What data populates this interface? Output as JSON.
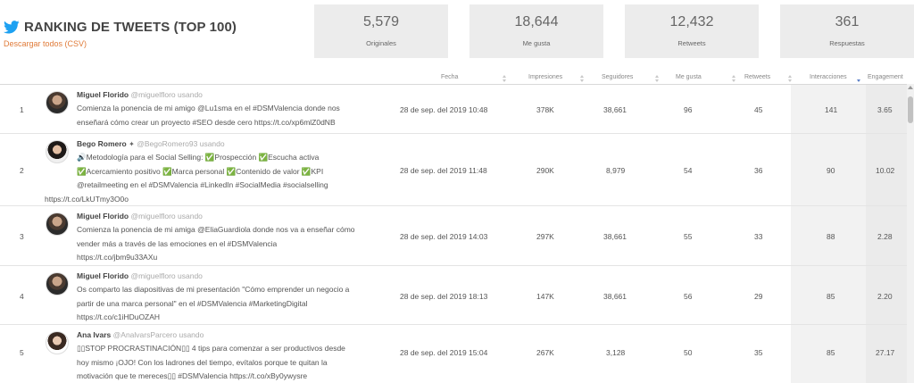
{
  "header": {
    "title": "RANKING DE TWEETS (TOP 100)",
    "download_label": "Descargar todos (CSV)",
    "stats": [
      {
        "value": "5,579",
        "label": "Originales"
      },
      {
        "value": "18,644",
        "label": "Me gusta"
      },
      {
        "value": "12,432",
        "label": "Retweets"
      },
      {
        "value": "361",
        "label": "Respuestas"
      }
    ]
  },
  "columns": {
    "fecha": "Fecha",
    "impresiones": "Impresiones",
    "seguidores": "Seguidores",
    "megusta": "Me gusta",
    "retweets": "Retweets",
    "interacciones": "Interacciones",
    "engagement": "Engagement"
  },
  "colors": {
    "accent": "#e07b39",
    "twitter": "#1da1f2",
    "sort_active": "#5b7fc7"
  },
  "rows": [
    {
      "rank": "1",
      "name": "Miguel Florido",
      "handle": "@miguelfloro usando",
      "tweet_lines": [
        "Comienza la ponencia de mi amigo @Lu1sma en el #DSMValencia donde nos",
        "enseñará cómo crear un proyecto #SEO desde cero https://t.co/xp6mlZ0dNB"
      ],
      "fecha": "28 de sep. del 2019 10:48",
      "impresiones": "378K",
      "seguidores": "38,661",
      "megusta": "96",
      "retweets": "45",
      "interacciones": "141",
      "engagement": "3.65"
    },
    {
      "rank": "2",
      "name": "Bego Romero",
      "handle": "@BegoRomero93 usando",
      "tweet_lines": [
        "🔊Metodología para el Social Selling: ✅Prospección ✅Escucha activa",
        "✅Acercamiento positivo ✅Marca personal ✅Contenido de valor ✅KPI",
        "@retailmeeting en el #DSMValencia #LinkedIn #SocialMedia #socialselling",
        "https://t.co/LkUTmy3O0o"
      ],
      "fecha": "28 de sep. del 2019 11:48",
      "impresiones": "290K",
      "seguidores": "8,979",
      "megusta": "54",
      "retweets": "36",
      "interacciones": "90",
      "engagement": "10.02"
    },
    {
      "rank": "3",
      "name": "Miguel Florido",
      "handle": "@miguelfloro usando",
      "tweet_lines": [
        "Comienza la ponencia de mi amiga @EliaGuardiola donde nos va a enseñar cómo",
        "vender más a través de las emociones en el #DSMValencia",
        "https://t.co/jbm9u33AXu"
      ],
      "fecha": "28 de sep. del 2019 14:03",
      "impresiones": "297K",
      "seguidores": "38,661",
      "megusta": "55",
      "retweets": "33",
      "interacciones": "88",
      "engagement": "2.28"
    },
    {
      "rank": "4",
      "name": "Miguel Florido",
      "handle": "@miguelfloro usando",
      "tweet_lines": [
        "Os comparto las diapositivas de mi presentación \"Cómo emprender un negocio a",
        "partir de una marca personal\" en el #DSMValencia #MarketingDigital",
        "https://t.co/c1iHDuOZAH"
      ],
      "fecha": "28 de sep. del 2019 18:13",
      "impresiones": "147K",
      "seguidores": "38,661",
      "megusta": "56",
      "retweets": "29",
      "interacciones": "85",
      "engagement": "2.20"
    },
    {
      "rank": "5",
      "name": "Ana Ivars",
      "handle": "@AnalvarsParcero usando",
      "tweet_lines": [
        "▯▯STOP PROCRASTINACIÓN▯▯ 4 tips para comenzar a ser productivos desde",
        "hoy mismo ¡OJO! Con los ladrones del tiempo, evítalos porque te quitan la",
        "motivación que te mereces▯▯ #DSMValencia https://t.co/xBy0ywysre"
      ],
      "fecha": "28 de sep. del 2019 15:04",
      "impresiones": "267K",
      "seguidores": "3,128",
      "megusta": "50",
      "retweets": "35",
      "interacciones": "85",
      "engagement": "27.17"
    }
  ]
}
